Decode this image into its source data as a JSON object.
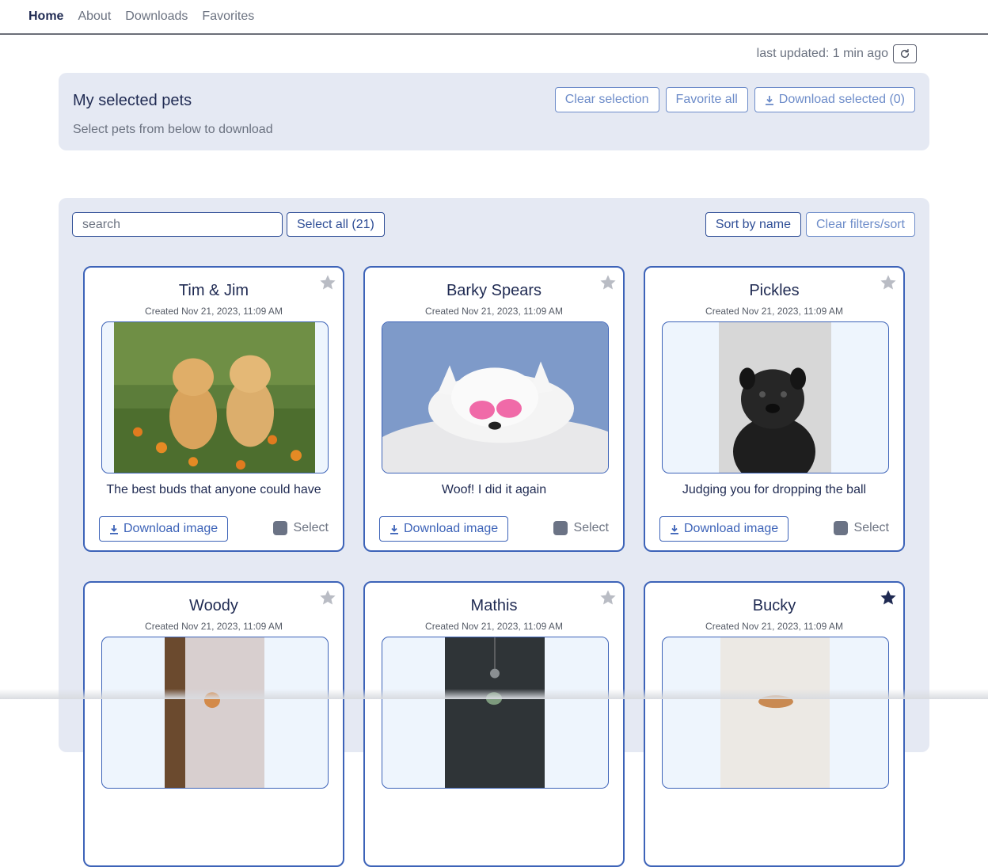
{
  "nav": {
    "items": [
      "Home",
      "About",
      "Downloads",
      "Favorites"
    ],
    "active": "Home"
  },
  "status": {
    "last_updated": "last updated: 1 min ago",
    "refresh_icon": "refresh-icon"
  },
  "selection": {
    "title": "My selected pets",
    "subtitle": "Select pets from below to download",
    "clear_label": "Clear selection",
    "favorite_all_label": "Favorite all",
    "download_selected_label": "Download selected (0)"
  },
  "toolbar": {
    "search_placeholder": "search",
    "select_all_label": "Select all (21)",
    "sort_label": "Sort by name",
    "clear_filters_label": "Clear filters/sort"
  },
  "card_labels": {
    "download": "Download image",
    "select": "Select"
  },
  "pets": [
    {
      "name": "Tim & Jim",
      "created": "Created Nov 21, 2023, 11:09 AM",
      "caption": "The best buds that anyone could have",
      "favorite": false
    },
    {
      "name": "Barky Spears",
      "created": "Created Nov 21, 2023, 11:09 AM",
      "caption": "Woof! I did it again",
      "favorite": false
    },
    {
      "name": "Pickles",
      "created": "Created Nov 21, 2023, 11:09 AM",
      "caption": "Judging you for dropping the ball",
      "favorite": false
    },
    {
      "name": "Woody",
      "created": "Created Nov 21, 2023, 11:09 AM",
      "caption": "",
      "favorite": false
    },
    {
      "name": "Mathis",
      "created": "Created Nov 21, 2023, 11:09 AM",
      "caption": "",
      "favorite": false
    },
    {
      "name": "Bucky",
      "created": "Created Nov 21, 2023, 11:09 AM",
      "caption": "",
      "favorite": true
    }
  ],
  "colors": {
    "accent": "#3d63b8",
    "panel_bg": "#e5e9f3",
    "star_off": "#b9bcc4",
    "star_on": "#1f2a52"
  }
}
